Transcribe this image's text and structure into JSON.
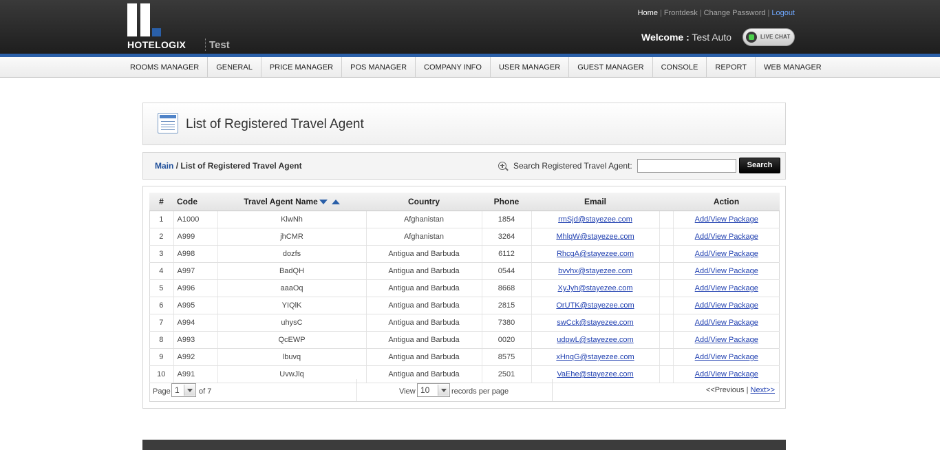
{
  "header": {
    "logo_text_hotel": "HOTEL",
    "logo_text_ogix": "OGIX",
    "hotel_name": "Test",
    "links": {
      "home": "Home",
      "frontdesk": "Frontdesk",
      "change_password": "Change Password",
      "logout": "Logout"
    },
    "separator": "|",
    "welcome_label": "Welcome :",
    "welcome_user": "Test Auto",
    "live_chat": "LIVE CHAT"
  },
  "nav": {
    "items": [
      "ROOMS MANAGER",
      "GENERAL",
      "PRICE MANAGER",
      "POS MANAGER",
      "COMPANY INFO",
      "USER MANAGER",
      "GUEST MANAGER",
      "CONSOLE",
      "REPORT",
      "WEB MANAGER"
    ]
  },
  "page": {
    "title": "List of Registered Travel Agent"
  },
  "breadcrumb": {
    "main": "Main",
    "separator": "/",
    "current": "List of Registered Travel Agent"
  },
  "search": {
    "label": "Search Registered Travel Agent:",
    "value": "",
    "button": "Search"
  },
  "table": {
    "columns": {
      "num": "#",
      "code": "Code",
      "name": "Travel Agent Name",
      "country": "Country",
      "phone": "Phone",
      "email": "Email",
      "action": "Action"
    },
    "rows": [
      {
        "num": "1",
        "code": "A1000",
        "name": "KlwNh",
        "country": "Afghanistan",
        "phone": "1854",
        "email": "rmSjd@stayezee.com",
        "action": "Add/View Package"
      },
      {
        "num": "2",
        "code": "A999",
        "name": "jhCMR",
        "country": "Afghanistan",
        "phone": "3264",
        "email": "MhlqW@stayezee.com",
        "action": "Add/View Package"
      },
      {
        "num": "3",
        "code": "A998",
        "name": "dozfs",
        "country": "Antigua and Barbuda",
        "phone": "6112",
        "email": "RhcgA@stayezee.com",
        "action": "Add/View Package"
      },
      {
        "num": "4",
        "code": "A997",
        "name": "BadQH",
        "country": "Antigua and Barbuda",
        "phone": "0544",
        "email": "bvvhx@stayezee.com",
        "action": "Add/View Package"
      },
      {
        "num": "5",
        "code": "A996",
        "name": "aaaOq",
        "country": "Antigua and Barbuda",
        "phone": "8668",
        "email": "XyJyh@stayezee.com",
        "action": "Add/View Package"
      },
      {
        "num": "6",
        "code": "A995",
        "name": "YIQlK",
        "country": "Antigua and Barbuda",
        "phone": "2815",
        "email": "OrUTK@stayezee.com",
        "action": "Add/View Package"
      },
      {
        "num": "7",
        "code": "A994",
        "name": "uhysC",
        "country": "Antigua and Barbuda",
        "phone": "7380",
        "email": "swCck@stayezee.com",
        "action": "Add/View Package"
      },
      {
        "num": "8",
        "code": "A993",
        "name": "QcEWP",
        "country": "Antigua and Barbuda",
        "phone": "0020",
        "email": "udpwL@stayezee.com",
        "action": "Add/View Package"
      },
      {
        "num": "9",
        "code": "A992",
        "name": "lbuvq",
        "country": "Antigua and Barbuda",
        "phone": "8575",
        "email": "xHnqG@stayezee.com",
        "action": "Add/View Package"
      },
      {
        "num": "10",
        "code": "A991",
        "name": "UvwJlq",
        "country": "Antigua and Barbuda",
        "phone": "2501",
        "email": "VaEhe@stayezee.com",
        "action": "Add/View Package"
      }
    ]
  },
  "pager": {
    "page_label": "Page",
    "page_value": "1",
    "of_label": "of 7",
    "view_label": "View",
    "view_value": "10",
    "records_label": "records per page",
    "previous": "<<Previous",
    "separator": "|",
    "next": "Next>>"
  }
}
